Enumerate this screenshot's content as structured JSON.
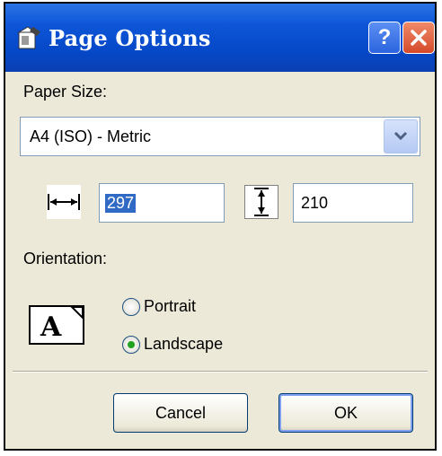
{
  "window": {
    "title": "Page Options",
    "help_label": "?",
    "close_label": "✕"
  },
  "paper": {
    "label": "Paper Size:",
    "selected": "A4 (ISO) - Metric",
    "width_value": "297",
    "height_value": "210"
  },
  "orientation": {
    "label": "Orientation:",
    "preview_letter": "A",
    "options": [
      "Portrait",
      "Landscape"
    ],
    "selected": "Landscape"
  },
  "buttons": {
    "cancel": "Cancel",
    "ok": "OK"
  },
  "colors": {
    "title_bar": "#0548c8",
    "dialog_bg": "#ece9d8",
    "close_button": "#d44a2a",
    "selection": "#316ac5"
  }
}
